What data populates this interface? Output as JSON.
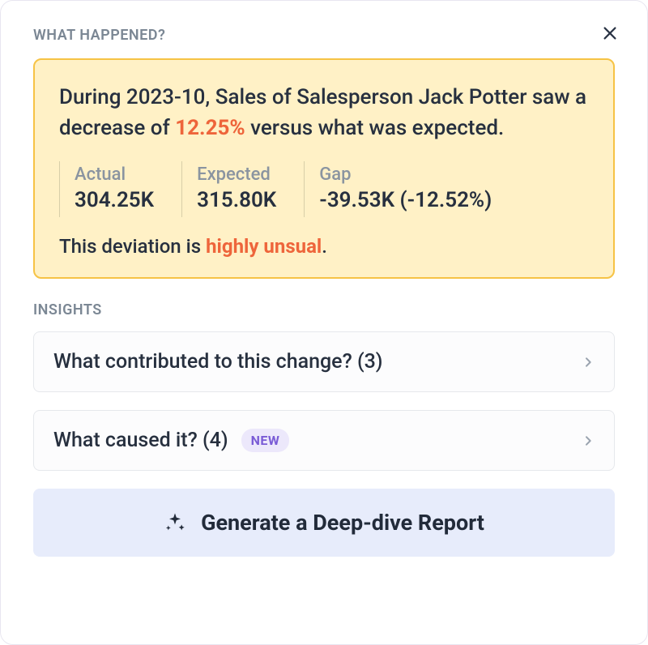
{
  "header": {
    "title": "WHAT HAPPENED?"
  },
  "summary": {
    "line_prefix": "During 2023-10, Sales of Salesperson Jack Potter saw a decrease of ",
    "pct": "12.25%",
    "line_suffix": " versus what was expected.",
    "metrics": {
      "actual": {
        "label": "Actual",
        "value": "304.25K"
      },
      "expected": {
        "label": "Expected",
        "value": "315.80K"
      },
      "gap": {
        "label": "Gap",
        "value": "-39.53K (-12.52%)"
      }
    },
    "deviation_prefix": "This deviation is ",
    "deviation_flag": "highly unsual",
    "deviation_suffix": "."
  },
  "insights": {
    "label": "INSIGHTS",
    "items": [
      {
        "title": "What contributed to this change? (3)",
        "badge": ""
      },
      {
        "title": "What caused it? (4)",
        "badge": "NEW"
      }
    ]
  },
  "actions": {
    "generate_label": "Generate a Deep-dive Report"
  }
}
